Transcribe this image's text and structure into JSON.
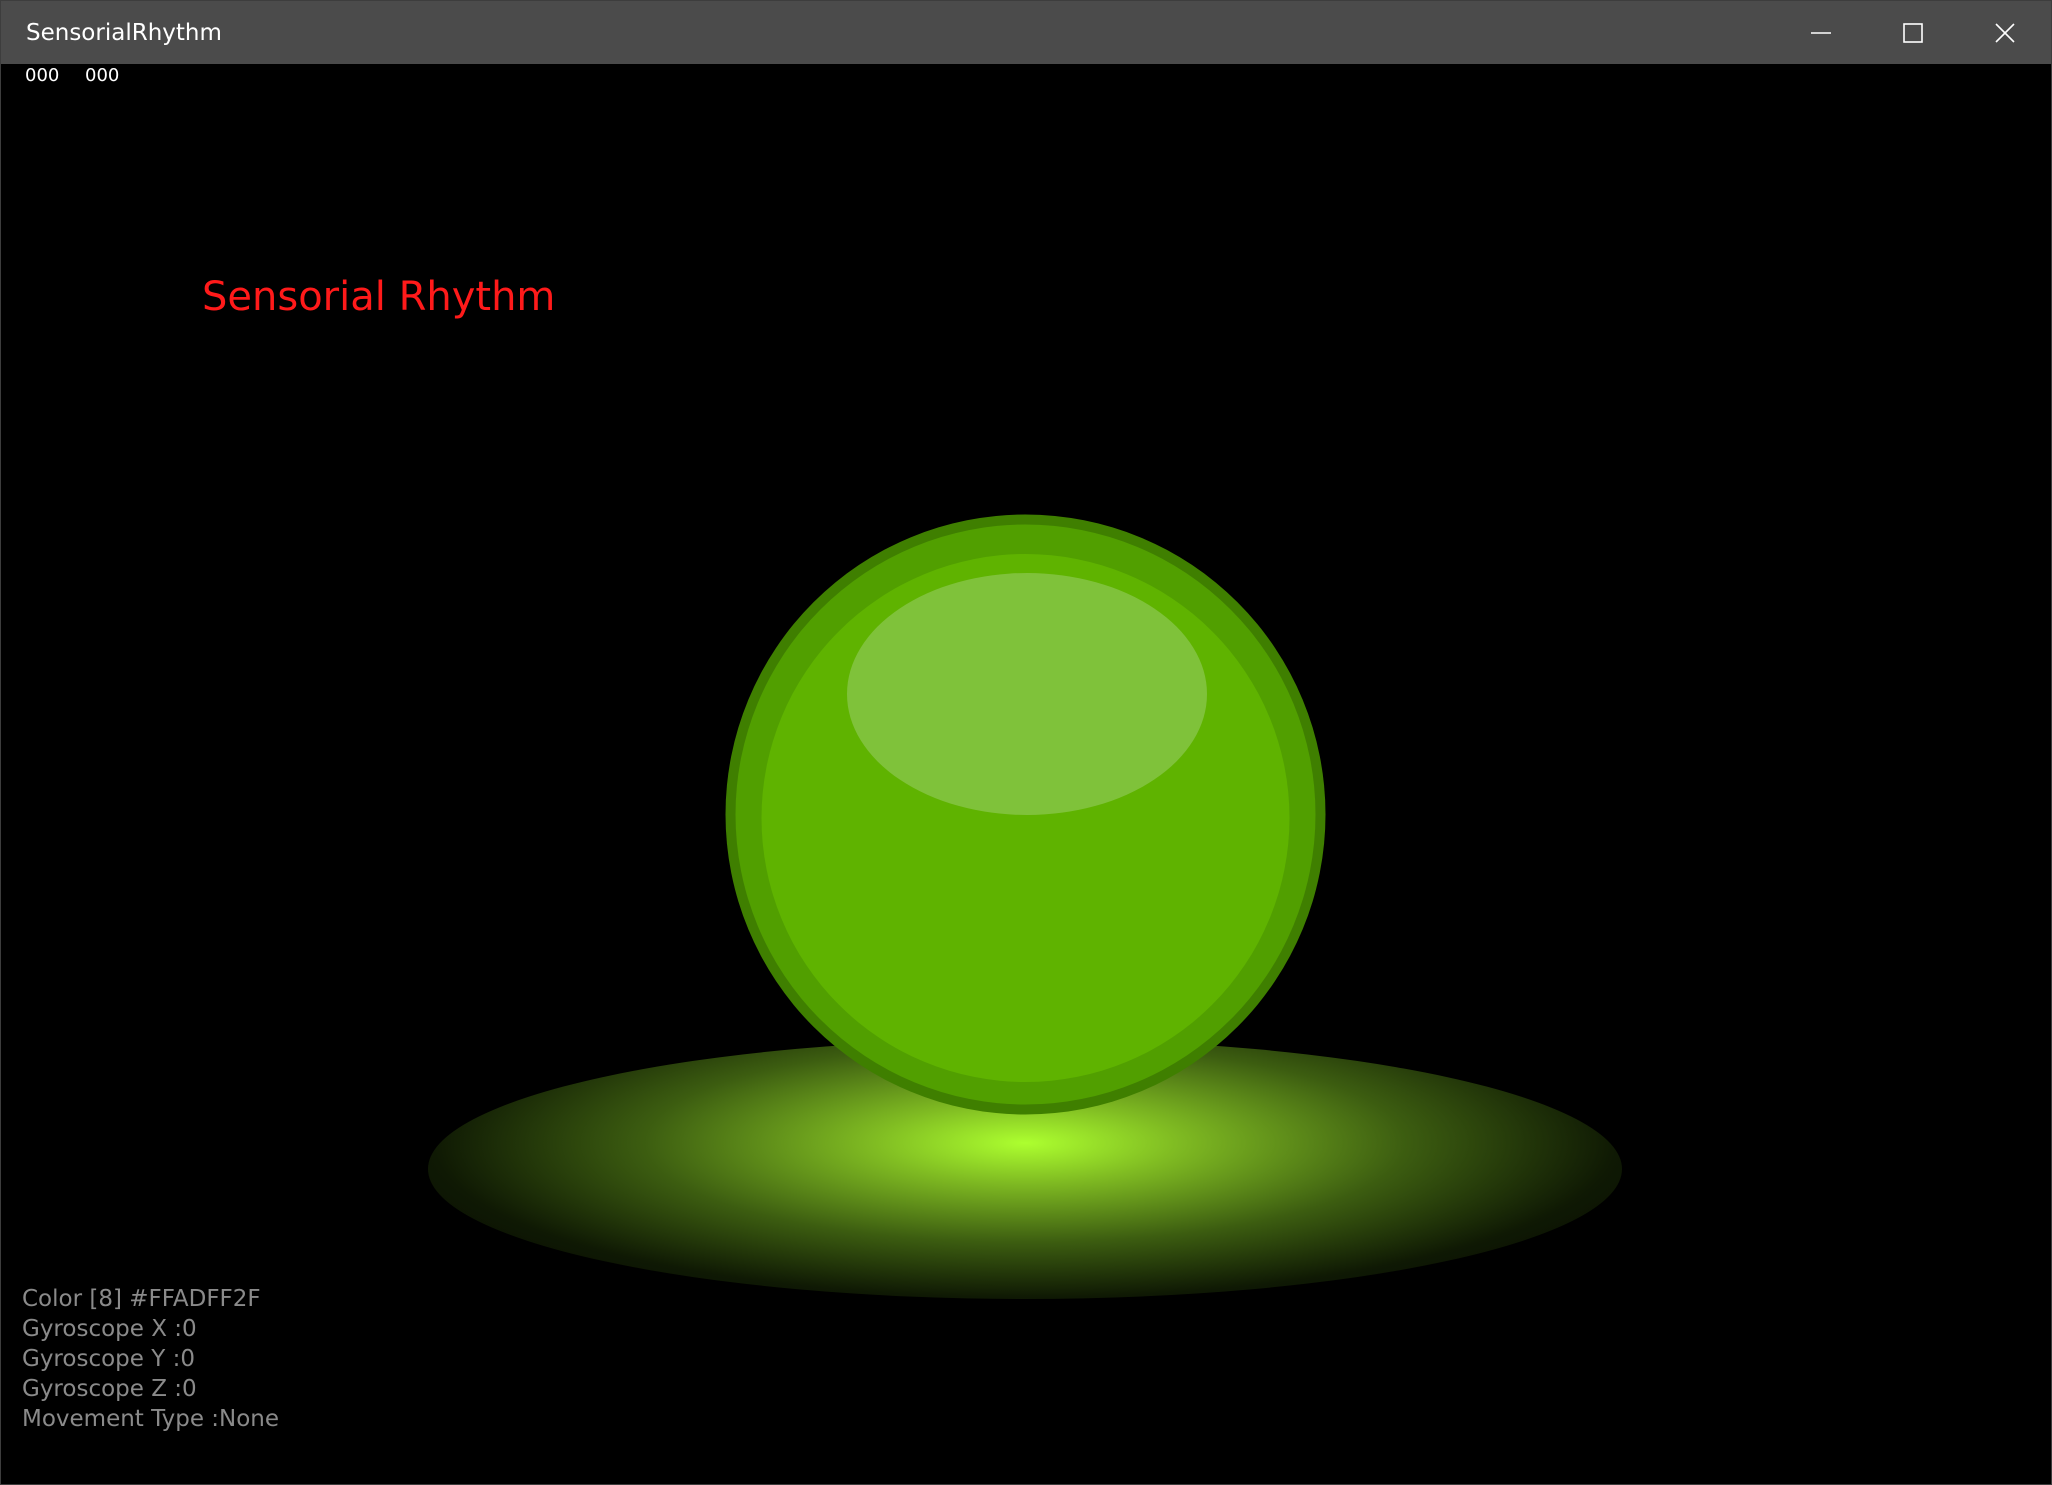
{
  "window": {
    "title": "SensorialRhythm",
    "controls": {
      "minimize_icon": "minimize-icon",
      "maximize_icon": "maximize-icon",
      "close_icon": "close-icon"
    }
  },
  "counters": [
    "000",
    "000"
  ],
  "heading": "Sensorial Rhythm",
  "sphere": {
    "color": "#ADFF2F",
    "rim_color": "#3f7f00",
    "body_color": "#5fb300",
    "highlight_color": "#7fc23a"
  },
  "readouts": {
    "color": "Color [8] #FFADFF2F",
    "gyro_x": "Gyroscope X :0",
    "gyro_y": "Gyroscope Y :0",
    "gyro_z": "Gyroscope Z :0",
    "movement": "Movement Type :None"
  }
}
